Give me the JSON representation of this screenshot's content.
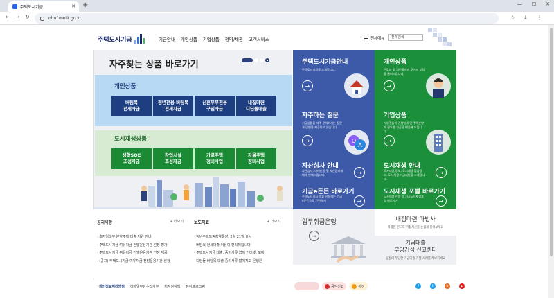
{
  "browser": {
    "tab_title": "주택도시기금",
    "url": "nhuf.molit.go.kr"
  },
  "header": {
    "logo": "주택도시기금",
    "nav": [
      "기금안내",
      "개인상품",
      "기업상품",
      "청약/채권",
      "고객서비스"
    ],
    "all_menu": "전체메뉴",
    "site_select": "전체검색"
  },
  "quick": {
    "title": "자주찾는 상품 바로가기",
    "personal": {
      "title": "개인상품",
      "buttons": [
        "버팀목\n전세자금",
        "청년전용 버팀목\n전세자금",
        "신혼부부전용\n구입자금",
        "내집마련\n디딤돌대출"
      ]
    },
    "urban": {
      "title": "도시재생상품",
      "buttons": [
        "생활SOC\n조성자금",
        "창업시설\n조성자금",
        "가로주택\n정비사업",
        "자율주택\n정비사업"
      ]
    }
  },
  "tiles": [
    {
      "title": "주택도시기금안내",
      "desc": "주택도시기금을 소개합니다."
    },
    {
      "title": "개인상품",
      "desc": "근로자 및 서민들에게 주거비 부담을 줄여드립니다."
    },
    {
      "title": "자주하는 질문",
      "desc": "기금상품을 자주 문의하시는 질문과 답변을 제공하고 있습니다."
    },
    {
      "title": "기업상품",
      "desc": "사업주들의 건설임대 및 주택분양에 필요한 자금을 대출해 드립니다."
    },
    {
      "title": "자산심사 안내",
      "desc": "자산심사, 미래산정 및 자산금리에 대해 안내드립니다."
    },
    {
      "title": "도시재생 안내",
      "desc": "도시재생 정보, 도시재생 금융정보, 도시재생 기금지원을 소개합니다."
    },
    {
      "title": "기금e든든 바로가기",
      "desc": "주택도시기금 대출 신청하는 기금e든든으로 간편하게"
    },
    {
      "title": "도시재생 포털 바로가기",
      "desc": "도시재생 전문 정 기금도시재생포털 바로가기"
    }
  ],
  "notices": {
    "title": "공지사항",
    "more": "+ 더보기",
    "items": [
      "초지임대부 분양주택 대출 지원 안내",
      "주택도시기금 여유자금 전담운용기관 선정 평가",
      "주택도시기금 여유자금 전담운용기관 선정 재공",
      "(공고) 주택도시기금 여유자금 전담운용기관 선정"
    ]
  },
  "press": {
    "title": "보도자료",
    "more": "+ 더보기",
    "items": [
      "청년주택드림청약통장, 2월 21일 출시",
      "버팀목 전세대출 이용이 편리해집니다",
      "주택도시기금 대출, 중이서류 없이 인터넷, 모바",
      "디딤돌·버팀목 대출 중이서류 없어지고 은행은"
    ]
  },
  "bank": {
    "title": "업무취급은행"
  },
  "magic": {
    "title": "내집마련 마법사",
    "desc": "복잡한 펀드와 가점계산을 손쉽게 풀어보세요"
  },
  "report": {
    "title": "기금대출\n부당거점 신고센터",
    "desc": "공정의 부당한 기금대출 거절 사례를 제보하세요"
  },
  "footer": {
    "links": [
      "개인정보처리방침",
      "이메일무단수집거부",
      "저작권정책",
      "뷰어프로그램"
    ],
    "banners": [
      "",
      "공익신고",
      "아이"
    ]
  },
  "colors": {
    "navy": "#1d3f82",
    "tile_blue": "#3d5aa8",
    "tile_green": "#1b8f3a",
    "personal_bg": "#b7d9f4",
    "urban_bg": "#d6ebd1"
  }
}
